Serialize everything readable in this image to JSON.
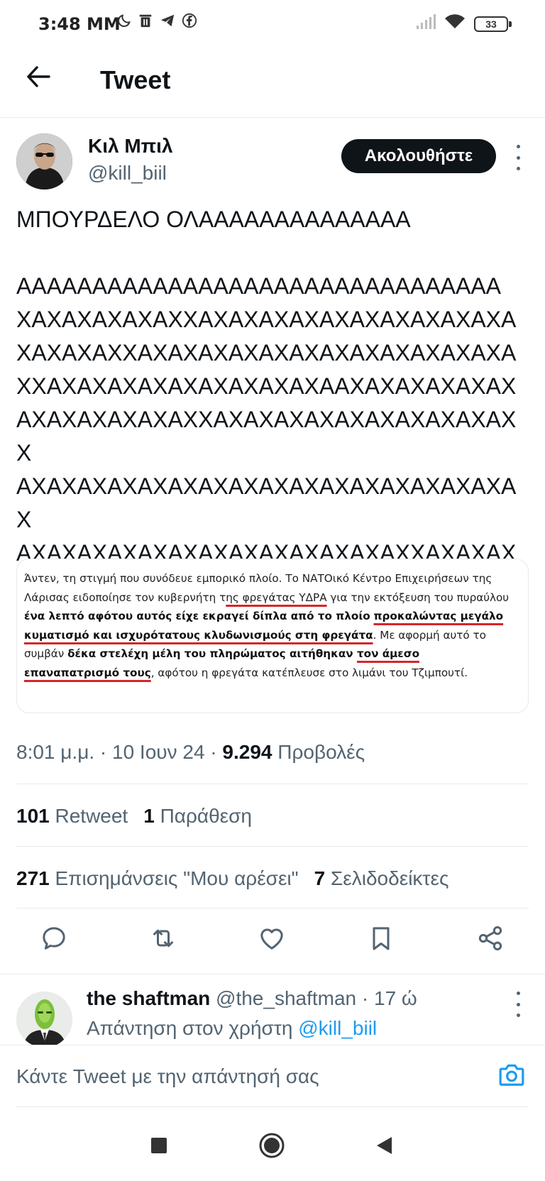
{
  "status_bar": {
    "time": "3:48 ΜΜ",
    "battery": "33",
    "left_icons": [
      "moon-icon",
      "trash-icon",
      "telegram-icon",
      "facebook-icon"
    ],
    "right_icons": [
      "signal-icon",
      "wifi-icon",
      "battery-icon"
    ]
  },
  "header": {
    "title": "Tweet",
    "back_icon": "arrow-left-icon"
  },
  "tweet": {
    "author_name": "Κιλ Μπιλ",
    "author_handle": "@kill_biil",
    "follow_label": "Ακολουθήστε",
    "text": "ΜΠΟΥΡΔΕΛΟ ΟΛΑΑΑΑΑΑΑΑΑΑΑΑΑΑ\n\nΑΑΑΑΑΑΑΑΑΑΑΑΑΑΑΑΑΑΑΑΑΑΑΑΑΑΑΑΑΑΑΑ\nΧΑΧΑΧΑΧΑΧΑΧΧΑΧΑΧΑΧΑΧΑΧΑΧΑΧΑΧΑΧΑΧΑ\nΧΑΧΑΧΑΧΧΑΧΑΧΑΧΑΧΑΧΑΧΑΧΑΧΑΧΑΧΑΧΑΧΑ\nΧΧΑΧΑΧΑΧΑΧΑΧΑΧΑΧΑΧΑΧΑΑΧΑΧΑΧΑΧΑΧΑΧ\nΑΧΑΧΑΧΑΧΑΧΑΧΧΑΧΑΧΑΧΑΧΑΧΑΧΑΧΑΧΑΧΑΧΧ\nΑΧΑΧΑΧΑΧΑΧΑΧΑΧΑΧΑΧΑΧΑΧΑΧΑΧΑΧΑΧΑΧΑΧ\nΑΧΑΧΑΧΑΧΑΧΑΧΑΧΑΧΑΧΑΧΑΧΑΧΑΧΧΑΧΑΧΑΧΑ\nΧΑΧΧΧΑΧΑΧΑΧΑΧΧΧΑΧΑΧΑ",
    "media_article": {
      "p1": "Άντεν, τη στιγμή που συνόδευε εμπορικό πλοίο. Το ΝΑΤΟικό Κέντρο Επιχειρήσεων της Λάρισας ειδοποίησε τον κυβερνήτη τ",
      "p2": "ης φρεγάτας ΥΔΡΑ",
      "p3": " για την εκτόξευση του πυραύλου ",
      "p4": "ένα λεπτό αφότου αυτός είχε εκραγεί δίπλα από το πλοίο",
      "p5": " ",
      "p6": "προκαλώντας μεγάλο κυματισμό και ισχυρότατους κλυδωνισμούς στη φρεγάτα",
      "p7": ". Με αφορμή αυτό το συμβάν ",
      "p8": "δέκα στελέχη μέλη του πληρώματος αιτήθηκαν ",
      "p9": "τον άμεσο επαναπατρισμό τους",
      "p10": ", αφότου η φρεγάτα κατέπλευσε στο λιμάνι του Τζιμπουτί."
    },
    "time": "8:01 μ.μ.",
    "sep1": " · ",
    "date": "10 Ιουν 24",
    "sep2": " · ",
    "views_count": "9.294",
    "views_label": " Προβολές",
    "retweets_count": "101",
    "retweets_label": " Retweet",
    "quotes_count": "1",
    "quotes_label": " Παράθεση",
    "likes_count": "271",
    "likes_label": " Επισημάνσεις \"Μου αρέσει\"",
    "bookmarks_count": "7",
    "bookmarks_label": " Σελιδοδείκτες"
  },
  "actions": [
    "reply-icon",
    "retweet-icon",
    "like-icon",
    "bookmark-icon",
    "share-icon"
  ],
  "reply": {
    "name": "the shaftman",
    "handle": " @the_shaftman",
    "time": " · 17 ώ",
    "replying_to_prefix": "Απάντηση στον χρήστη ",
    "replying_to_handle": "@kill_biil"
  },
  "compose": {
    "placeholder": "Κάντε Tweet με την απάντησή σας"
  },
  "colors": {
    "accent": "#1d9bf0",
    "text": "#0f1419",
    "muted": "#536471",
    "underline": "#d6262a"
  }
}
